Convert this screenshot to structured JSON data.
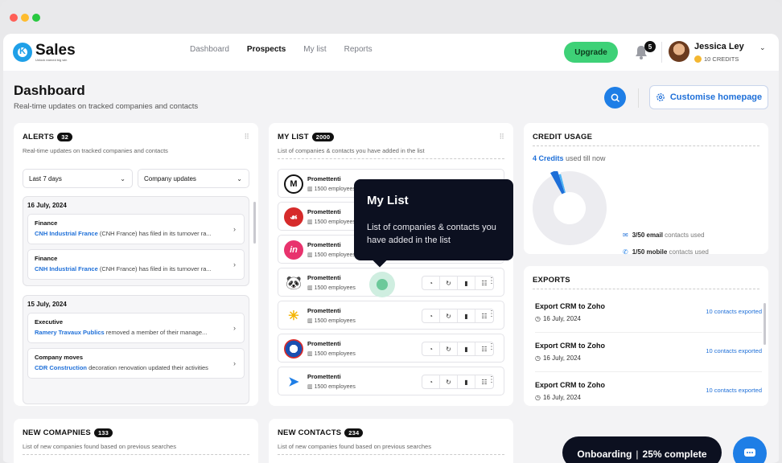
{
  "app": {
    "name": "Sales",
    "tagline": "Unlock earned big win"
  },
  "nav": {
    "items": [
      "Dashboard",
      "Prospects",
      "My list",
      "Reports"
    ],
    "active": "Prospects"
  },
  "header": {
    "upgrade": "Upgrade",
    "notifications": "5",
    "user_name": "Jessica Ley",
    "credits": "10 CREDITS"
  },
  "page": {
    "title": "Dashboard",
    "subtitle": "Real-time updates on tracked companies and contacts",
    "customise": "Customise homepage"
  },
  "alerts": {
    "title": "ALERTS",
    "count": "32",
    "subtitle": "Real-time updates on tracked companies and contacts",
    "filter_period": "Last 7 days",
    "filter_type": "Company updates",
    "groups": [
      {
        "date": "16 July, 2024",
        "items": [
          {
            "type": "Finance",
            "company": "CNH Industrial France",
            "text": " (CNH France) has filed in its turnover ra..."
          },
          {
            "type": "Finance",
            "company": "CNH Industrial France",
            "text": " (CNH France) has filed in its turnover ra..."
          }
        ]
      },
      {
        "date": "15 July, 2024",
        "items": [
          {
            "type": "Executive",
            "company": "Ramery Travaux Publics",
            "text": " removed a member of their manage..."
          },
          {
            "type": "Company moves",
            "company": "CDR Construction",
            "text": " decoration renovation updated their activities"
          }
        ]
      }
    ]
  },
  "mylist": {
    "title": "MY LIST",
    "count": "2000",
    "subtitle": "List of companies & contacts you have added in the list",
    "items": [
      {
        "name": "Promettenti",
        "employees": "1500 employees"
      },
      {
        "name": "Promettenti",
        "employees": "1500 employees"
      },
      {
        "name": "Promettenti",
        "employees": "1500 employees"
      },
      {
        "name": "Promettenti",
        "employees": "1500 employees"
      },
      {
        "name": "Promettenti",
        "employees": "1500 employees"
      },
      {
        "name": "Promettenti",
        "employees": "1500 employees"
      },
      {
        "name": "Promettenti",
        "employees": "1500 employees"
      }
    ]
  },
  "tooltip": {
    "title": "My List",
    "text": "List of companies & contacts you have added in the list"
  },
  "credit": {
    "title": "CREDIT USAGE",
    "used": "4 Credits",
    "used_suffix": " used till now",
    "email_count": "3/50 email",
    "email_suffix": " contacts used",
    "mobile_count": "1/50 mobile",
    "mobile_suffix": " contacts used",
    "chart_data": {
      "type": "pie",
      "categories": [
        "email",
        "mobile",
        "remaining"
      ],
      "values": [
        3,
        1,
        96
      ]
    }
  },
  "exports": {
    "title": "EXPORTS",
    "items": [
      {
        "name": "Export CRM to Zoho",
        "date": "16 July, 2024",
        "count": "10 contacts exported"
      },
      {
        "name": "Export CRM to Zoho",
        "date": "16 July, 2024",
        "count": "10 contacts exported"
      },
      {
        "name": "Export CRM to Zoho",
        "date": "16 July, 2024",
        "count": "10 contacts exported"
      }
    ]
  },
  "new_companies": {
    "title": "NEW COMAPNIES",
    "count": "133",
    "subtitle": "List of new companies found based on previous searches"
  },
  "new_contacts": {
    "title": "NEW CONTACTS",
    "count": "234",
    "subtitle": "List of new companies found based on previous searches"
  },
  "onboarding": {
    "label": "Onboarding",
    "progress": "25% complete"
  },
  "colors": {
    "accent": "#1e7ee6",
    "upgrade": "#3ed177",
    "dark": "#0c1020",
    "link": "#1e6fd8"
  }
}
